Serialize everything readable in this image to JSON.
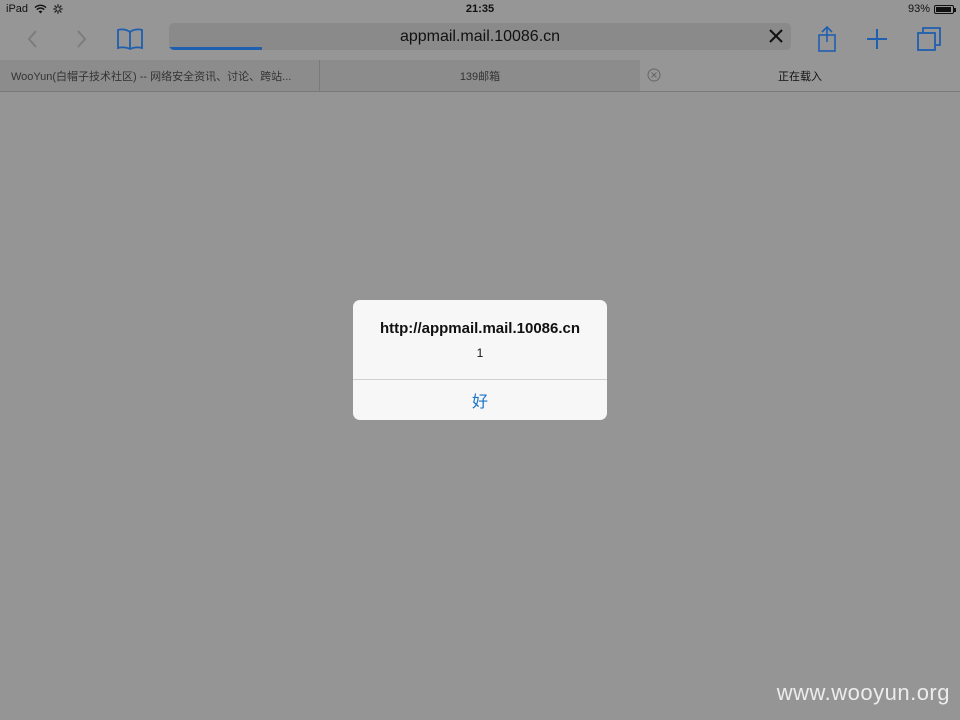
{
  "status_bar": {
    "device": "iPad",
    "time": "21:35",
    "battery": "93%",
    "battery_level": 0.93,
    "icons": [
      "wifi-icon",
      "activity-spinner-icon",
      "battery-icon"
    ]
  },
  "toolbar": {
    "url": "appmail.mail.10086.cn",
    "load_progress": 0.15,
    "accent_color": "#1f5fb0",
    "icons": [
      "back-icon",
      "forward-icon",
      "bookmarks-icon",
      "clear-icon",
      "share-icon",
      "new-tab-icon",
      "tabs-icon"
    ]
  },
  "tabs": [
    {
      "label": "WooYun(白帽子技术社区) -- 网络安全资讯、讨论、跨站..."
    },
    {
      "label": "139邮箱"
    },
    {
      "label": "正在载入"
    }
  ],
  "alert": {
    "title": "http://appmail.mail.10086.cn",
    "message": "1",
    "button": "好",
    "button_color": "#1a73c8"
  },
  "watermark": "www.wooyun.org"
}
